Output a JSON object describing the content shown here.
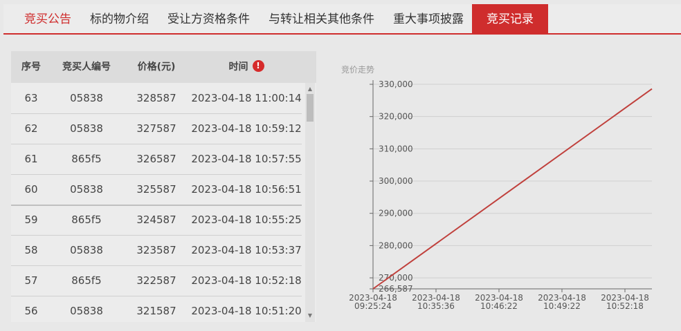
{
  "tabs": [
    {
      "label": "竞买公告"
    },
    {
      "label": "标的物介绍"
    },
    {
      "label": "受让方资格条件"
    },
    {
      "label": "与转让相关其他条件"
    },
    {
      "label": "重大事项披露"
    },
    {
      "label": "竞买记录",
      "active": true
    }
  ],
  "table": {
    "headers": {
      "seq": "序号",
      "bidder": "竞买人编号",
      "price": "价格(元)",
      "time": "时间"
    },
    "alert_icon": "exclamation-circle-icon",
    "rows": [
      {
        "seq": "63",
        "bidder": "05838",
        "price": "328587",
        "time": "2023-04-18 11:00:14"
      },
      {
        "seq": "62",
        "bidder": "05838",
        "price": "327587",
        "time": "2023-04-18 10:59:12"
      },
      {
        "seq": "61",
        "bidder": "865f5",
        "price": "326587",
        "time": "2023-04-18 10:57:55"
      },
      {
        "seq": "60",
        "bidder": "05838",
        "price": "325587",
        "time": "2023-04-18 10:56:51"
      },
      {
        "seq": "59",
        "bidder": "865f5",
        "price": "324587",
        "time": "2023-04-18 10:55:25"
      },
      {
        "seq": "58",
        "bidder": "05838",
        "price": "323587",
        "time": "2023-04-18 10:53:37"
      },
      {
        "seq": "57",
        "bidder": "865f5",
        "price": "322587",
        "time": "2023-04-18 10:52:18"
      },
      {
        "seq": "56",
        "bidder": "05838",
        "price": "321587",
        "time": "2023-04-18 10:51:20"
      }
    ]
  },
  "colors": {
    "accent": "#cf2d2d",
    "line": "#c0403c"
  },
  "chart_data": {
    "type": "line",
    "title": "竞价走势",
    "ylim": [
      266587,
      330000
    ],
    "ytick_labels": [
      "330,000",
      "320,000",
      "310,000",
      "300,000",
      "290,000",
      "280,000",
      "270,000",
      "266,587"
    ],
    "ytick_values": [
      330000,
      320000,
      310000,
      300000,
      290000,
      280000,
      270000,
      266587
    ],
    "xtick_labels": [
      {
        "date": "2023-04-18",
        "time": "09:25:24"
      },
      {
        "date": "2023-04-18",
        "time": "10:35:36"
      },
      {
        "date": "2023-04-18",
        "time": "10:46:22"
      },
      {
        "date": "2023-04-18",
        "time": "10:49:22"
      },
      {
        "date": "2023-04-18",
        "time": "10:52:18"
      }
    ],
    "x_range": [
      0,
      1
    ],
    "series": [
      {
        "points": [
          [
            0,
            266587
          ],
          [
            1,
            328587
          ]
        ]
      }
    ]
  }
}
